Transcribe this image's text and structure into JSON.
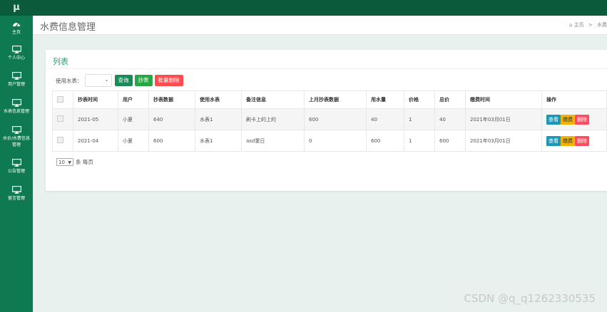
{
  "logo": {
    "text": "μ"
  },
  "sidebar": {
    "items": [
      {
        "label": "主页",
        "icon": "dashboard-icon"
      },
      {
        "label": "个人中心",
        "icon": "monitor-icon"
      },
      {
        "label": "用户管理",
        "icon": "monitor-icon"
      },
      {
        "label": "水表信息管理",
        "icon": "monitor-icon"
      },
      {
        "label": "水价/水费信息管理",
        "icon": "monitor-icon"
      },
      {
        "label": "公告管理",
        "icon": "monitor-icon"
      },
      {
        "label": "留言管理",
        "icon": "monitor-icon"
      }
    ]
  },
  "header": {
    "title": "水费信息管理",
    "breadcrumb": {
      "home": "主页",
      "separator": ">",
      "current": "水费"
    }
  },
  "card": {
    "title": "列表",
    "toolbar": {
      "label": "使用水表：",
      "select_value": "",
      "query_button": "查询",
      "read_button": "抄表",
      "batch_delete_button": "批量删除"
    },
    "table": {
      "columns": [
        "抄表时间",
        "用户",
        "抄表数据",
        "使用水表",
        "备注信息",
        "上月抄表数据",
        "用水量",
        "价格",
        "总价",
        "缴费时间",
        "操作"
      ],
      "rows": [
        {
          "time": "2021-05",
          "user": "小夏",
          "reading": "640",
          "meter": "水表1",
          "note": "刷卡上的上的",
          "last_reading": "600",
          "usage": "40",
          "price": "1",
          "total": "40",
          "pay_time": "2021年03月01日"
        },
        {
          "time": "2021-04",
          "user": "小夏",
          "reading": "600",
          "meter": "水表1",
          "note": "asd重日",
          "last_reading": "0",
          "usage": "600",
          "price": "1",
          "total": "600",
          "pay_time": "2021年03月01日"
        }
      ],
      "actions": {
        "view": "查看",
        "pay": "缴费",
        "delete": "删除"
      }
    },
    "pager": {
      "page_size": "10",
      "suffix": "条 每页"
    }
  },
  "watermark": "CSDN @q_q1262330535",
  "colors": {
    "topbar": "#0b5a3c",
    "sidebar": "#0f7a52",
    "accent": "#27a36d",
    "danger": "#ff4d4f",
    "info": "#1b98b8",
    "warning": "#f0b400"
  }
}
